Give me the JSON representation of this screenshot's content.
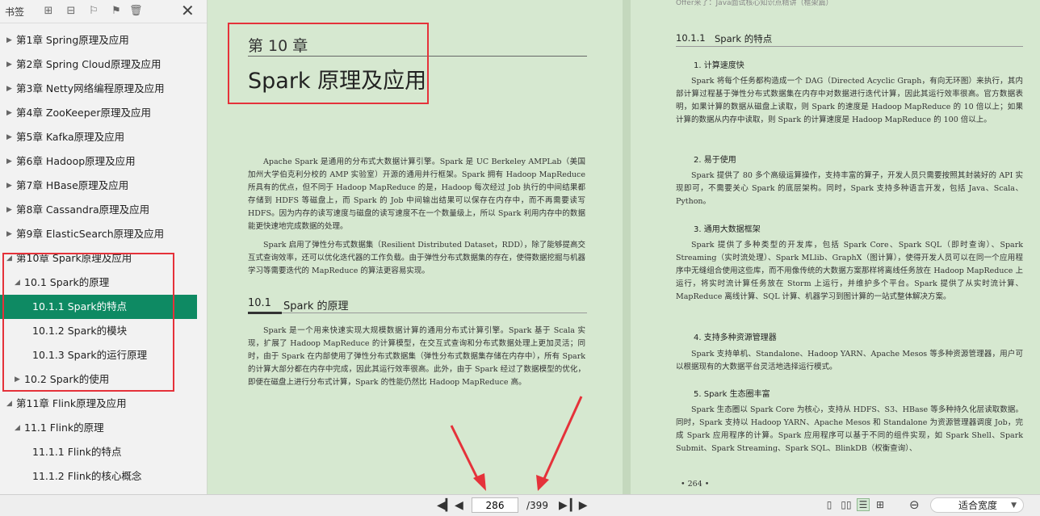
{
  "sidebar": {
    "title": "书签",
    "toolbar_icons": [
      "expand-all-icon",
      "collapse-all-icon",
      "add-bookmark-icon",
      "edit-bookmark-icon",
      "delete-bookmark-icon"
    ],
    "close_icon": "close-icon",
    "items": [
      {
        "label": "第1章 Spring原理及应用",
        "arrow": "▶"
      },
      {
        "label": "第2章 Spring Cloud原理及应用",
        "arrow": "▶"
      },
      {
        "label": "第3章 Netty网络编程原理及应用",
        "arrow": "▶"
      },
      {
        "label": "第4章 ZooKeeper原理及应用",
        "arrow": "▶"
      },
      {
        "label": "第5章 Kafka原理及应用",
        "arrow": "▶"
      },
      {
        "label": "第6章 Hadoop原理及应用",
        "arrow": "▶"
      },
      {
        "label": "第7章 HBase原理及应用",
        "arrow": "▶"
      },
      {
        "label": "第8章 Cassandra原理及应用",
        "arrow": "▶"
      },
      {
        "label": "第9章 ElasticSearch原理及应用",
        "arrow": "▶"
      },
      {
        "label": "第10章 Spark原理及应用",
        "arrow": "◢"
      },
      {
        "label": "10.1 Spark的原理",
        "arrow": "◢"
      },
      {
        "label": "10.1.1 Spark的特点"
      },
      {
        "label": "10.1.2 Spark的模块"
      },
      {
        "label": "10.1.3 Spark的运行原理"
      },
      {
        "label": "10.2 Spark的使用",
        "arrow": "▶"
      },
      {
        "label": "第11章 Flink原理及应用",
        "arrow": "◢"
      },
      {
        "label": "11.1 Flink的原理",
        "arrow": "◢"
      },
      {
        "label": "11.1.1 Flink的特点"
      },
      {
        "label": "11.1.2 Flink的核心概念"
      }
    ]
  },
  "left_page": {
    "chapter_num": "第 10 章",
    "chapter_title": "Spark 原理及应用",
    "p1": "Apache Spark 是通用的分布式大数据计算引擎。Spark 是 UC Berkeley AMPLab（美国加州大学伯克利分校的 AMP 实验室）开源的通用并行框架。Spark 拥有 Hadoop MapReduce 所具有的优点，但不同于 Hadoop MapReduce 的是，Hadoop 每次经过 Job 执行的中间结果都存储到 HDFS 等磁盘上，而 Spark 的 Job 中间输出结果可以保存在内存中，而不再需要读写 HDFS。因为内存的读写速度与磁盘的读写速度不在一个数量级上，所以 Spark 利用内存中的数据能更快速地完成数据的处理。",
    "p2": "Spark 启用了弹性分布式数据集（Resilient Distributed Dataset，RDD），除了能够提高交互式查询效率，还可以优化迭代器的工作负载。由于弹性分布式数据集的存在，使得数据挖掘与机器学习等需要迭代的 MapReduce 的算法更容易实现。",
    "section_num": "10.1",
    "section_title": "Spark 的原理",
    "p3": "Spark 是一个用来快速实现大规模数据计算的通用分布式计算引擎。Spark 基于 Scala 实现，扩展了 Hadoop MapReduce 的计算模型，在交互式查询和分布式数据处理上更加灵活；同时，由于 Spark 在内部使用了弹性分布式数据集（弹性分布式数据集存储在内存中），所有 Spark 的计算大部分都在内存中完成，因此其运行效率很高。此外，由于 Spark 经过了数据模型的优化，即便在磁盘上进行分布式计算，Spark 的性能仍然比 Hadoop MapReduce 高。"
  },
  "right_page": {
    "running_head": "Offer来了：Java面试核心知识点精讲（框架篇）",
    "section_num": "10.1.1",
    "section_title": "Spark 的特点",
    "h1": "1. 计算速度快",
    "p1": "Spark 将每个任务都构造成一个 DAG（Directed Acyclic Graph，有向无环图）来执行，其内部计算过程基于弹性分布式数据集在内存中对数据进行迭代计算，因此其运行效率很高。官方数据表明，如果计算的数据从磁盘上读取，则 Spark 的速度是 Hadoop MapReduce 的 10 倍以上；如果计算的数据从内存中读取，则 Spark 的计算速度是 Hadoop MapReduce 的 100 倍以上。",
    "h2": "2. 易于使用",
    "p2": "Spark 提供了 80 多个高级运算操作，支持丰富的算子，开发人员只需要按照其封装好的 API 实现即可，不需要关心 Spark 的底层架构。同时，Spark 支持多种语言开发，包括 Java、Scala、Python。",
    "h3": "3. 通用大数据框架",
    "p3": "Spark 提供了多种类型的开发库，包括 Spark Core、Spark SQL（即时查询）、Spark Streaming（实时流处理）、Spark MLlib、GraphX（图计算），使得开发人员可以在同一个应用程序中无缝组合使用这些库，而不用像传统的大数据方案那样将离线任务放在 Hadoop MapReduce 上运行，将实时流计算任务放在 Storm 上运行，并维护多个平台。Spark 提供了从实时流计算、MapReduce 离线计算、SQL 计算、机器学习到图计算的一站式整体解决方案。",
    "h4": "4. 支持多种资源管理器",
    "p4": "Spark 支持单机、Standalone、Hadoop YARN、Apache Mesos 等多种资源管理器，用户可以根据现有的大数据平台灵活地选择运行模式。",
    "h5": "5. Spark 生态圈丰富",
    "p5": "Spark 生态圈以 Spark Core 为核心，支持从 HDFS、S3、HBase 等多种持久化层读取数据。同时，Spark 支持以 Hadoop YARN、Apache Mesos 和 Standalone 为资源管理器调度 Job，完成 Spark 应用程序的计算。Spark 应用程序可以基于不同的组件实现，如 Spark Shell、Spark Submit、Spark Streaming、Spark SQL、BlinkDB（权衡查询）、",
    "page_number": "• 264 •"
  },
  "bottombar": {
    "current_page": "286",
    "total_pages": "/399",
    "zoom_mode": "适合宽度",
    "nav_icons": [
      "first-page-icon",
      "prev-page-icon",
      "next-page-icon",
      "last-page-icon"
    ],
    "view_icons": [
      "single-page-icon",
      "two-page-icon",
      "continuous-icon",
      "facing-icon"
    ]
  },
  "colors": {
    "active_toc": "#0e8a63",
    "highlight_red": "#e5323a",
    "page_bg": "#d6e8d0"
  }
}
